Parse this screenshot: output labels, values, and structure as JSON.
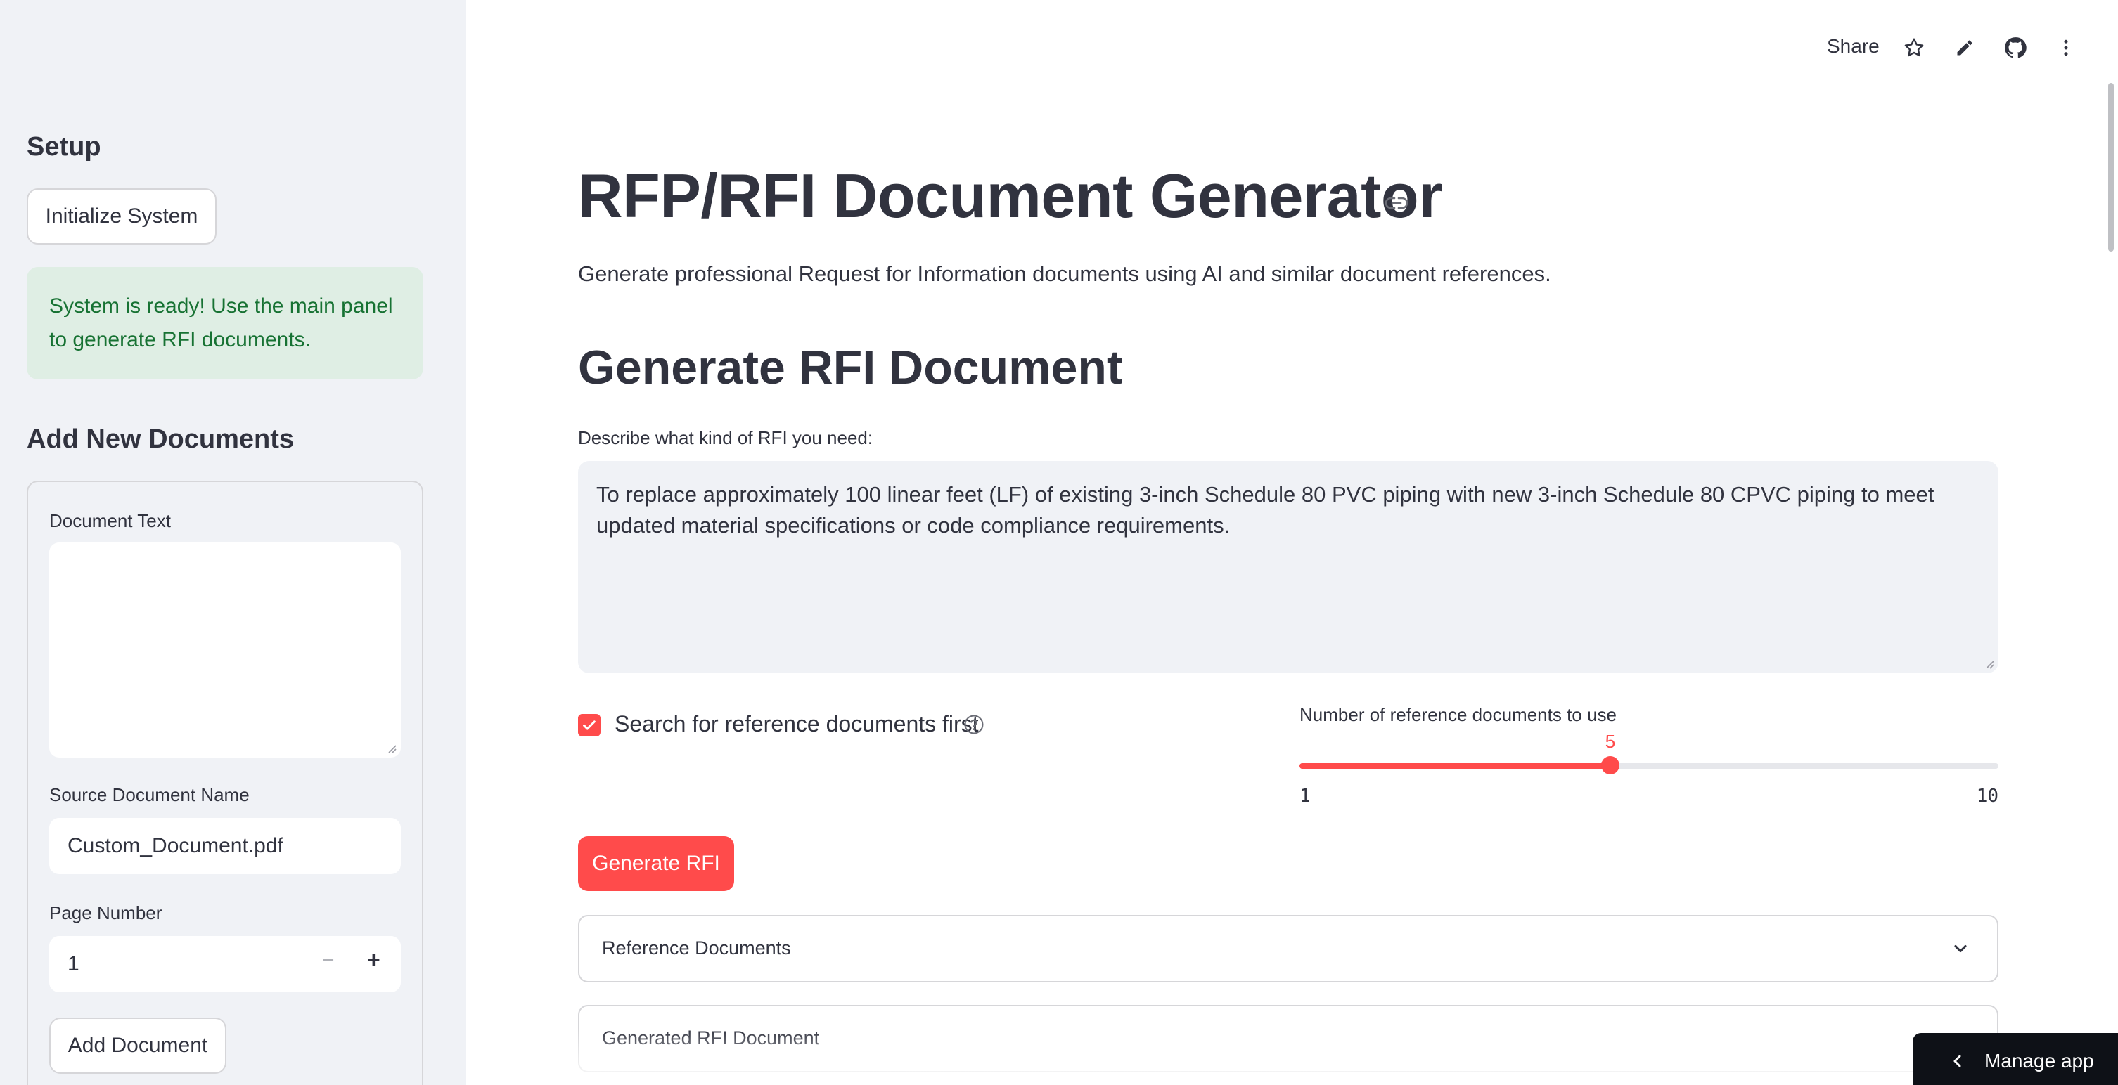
{
  "sidebar": {
    "setup_heading": "Setup",
    "init_button": "Initialize System",
    "success_message": "System is ready! Use the main panel to generate RFI documents.",
    "add_heading": "Add New Documents",
    "doc_text_label": "Document Text",
    "doc_text_value": "",
    "source_label": "Source Document Name",
    "source_value": "Custom_Document.pdf",
    "page_label": "Page Number",
    "page_value": "1",
    "minus_symbol": "−",
    "plus_symbol": "+",
    "add_button": "Add Document"
  },
  "toolbar": {
    "share": "Share",
    "icons": [
      "star-icon",
      "pencil-icon",
      "github-icon",
      "more-vertical-icon"
    ]
  },
  "main": {
    "title": "RFP/RFI Document Generator",
    "subtitle": "Generate professional Request for Information documents using AI and similar document references.",
    "section_heading": "Generate RFI Document",
    "query_label": "Describe what kind of RFI you need:",
    "query_value": "To replace approximately 100 linear feet (LF) of existing 3-inch Schedule 80 PVC piping with new 3-inch Schedule 80 CPVC piping to meet updated material specifications or code compliance requirements.",
    "checkbox_label": "Search for reference documents first",
    "checkbox_checked": true,
    "slider_label": "Number of reference documents to use",
    "slider_value": 5,
    "slider_min": 1,
    "slider_max": 10,
    "slider_value_text": "5",
    "slider_min_text": "1",
    "slider_max_text": "10",
    "generate_button": "Generate RFI",
    "expanders": [
      "Reference Documents",
      "Generated RFI Document"
    ]
  },
  "manage_app": "Manage app",
  "colors": {
    "accent": "#ff4b4b",
    "sidebar_bg": "#f0f2f6",
    "success_bg": "#dfeee4",
    "success_text": "#177233",
    "text": "#31333f"
  }
}
